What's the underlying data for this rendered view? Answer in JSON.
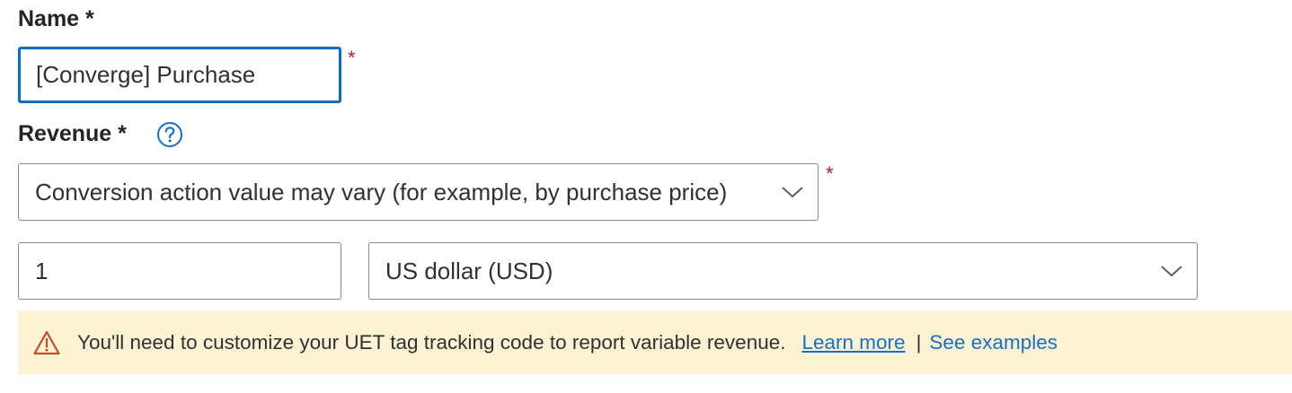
{
  "name_section": {
    "label": "Name *",
    "required_marker": "*",
    "value": "[Converge] Purchase"
  },
  "revenue_section": {
    "label": "Revenue *",
    "help_icon": "question-circle-icon",
    "required_marker": "*",
    "revenue_type_selected": "Conversion action value may vary (for example, by purchase price)",
    "amount_value": "1",
    "currency_selected": "US dollar (USD)"
  },
  "warning": {
    "icon": "warning-triangle-icon",
    "message": "You'll need to customize your UET tag tracking code to report variable revenue.",
    "learn_more_link": "Learn more",
    "separator": "|",
    "see_examples_link": "See examples",
    "background_color": "#fbf3d3",
    "icon_color": "#c14e2a",
    "link_color": "#1b6ec2"
  },
  "colors": {
    "focus_border": "#0f6cbd",
    "required_star": "#a4262c",
    "help_icon": "#1b6ec2"
  }
}
